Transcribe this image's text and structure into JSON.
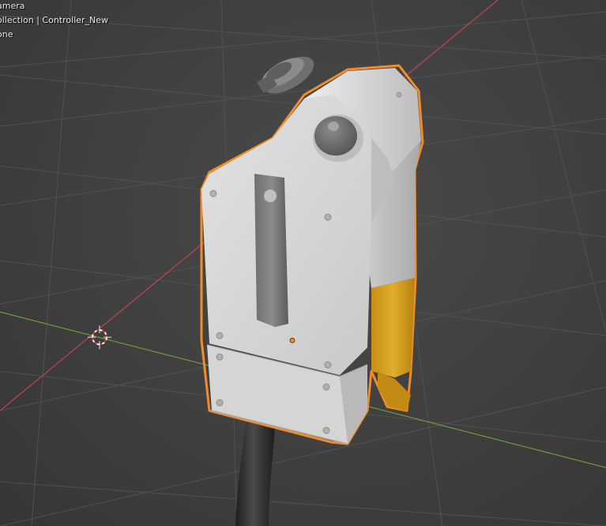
{
  "viewport": {
    "overlay": {
      "view_name": "amera",
      "collection_path": "ollection | Controller_New",
      "status": "one"
    }
  },
  "scene": {
    "object_name": "Controller_New",
    "selected": true,
    "icons": {
      "cursor": "3d-cursor-icon",
      "origin": "object-origin-icon"
    },
    "colors": {
      "selection_outline": "#f28c28",
      "body": "#d9d9d9",
      "accent": "#d9a520",
      "x_axis": "#c2444d",
      "y_axis": "#6e9a3a",
      "grid": "#555555",
      "cable": "#2b2b2b"
    }
  }
}
